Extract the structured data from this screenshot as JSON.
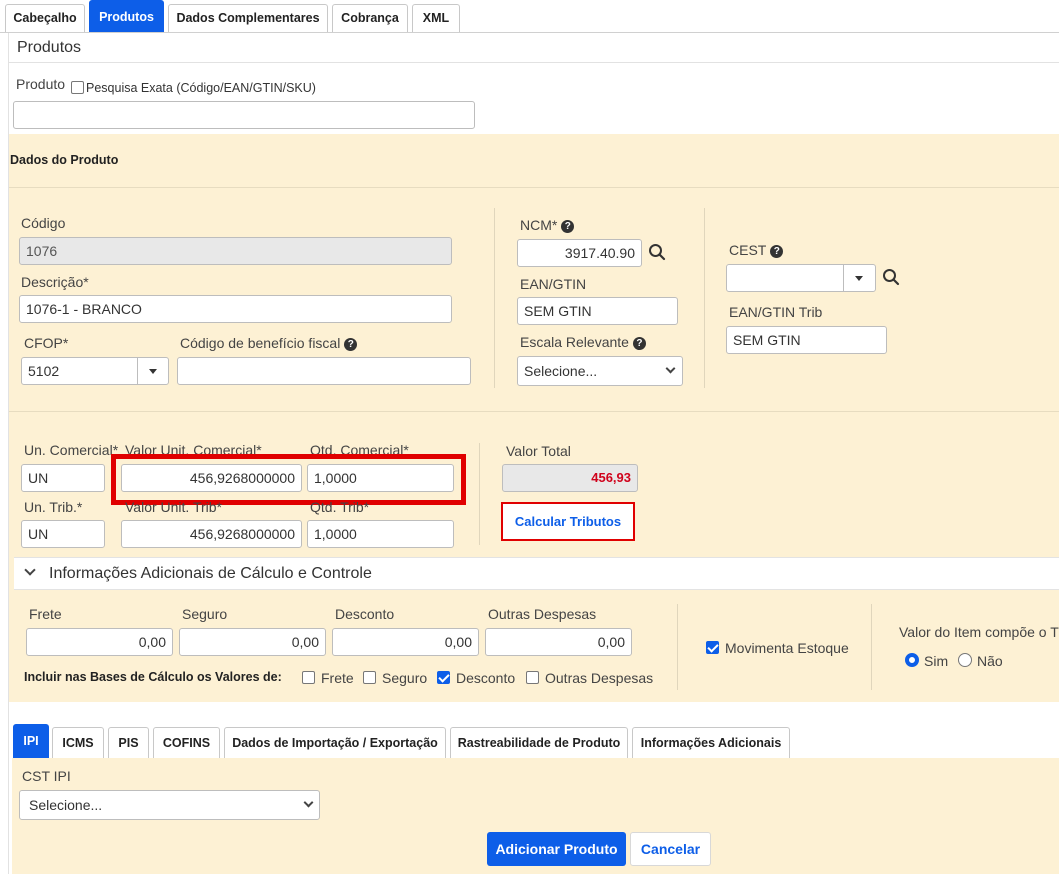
{
  "top_tabs": [
    "Cabeçalho",
    "Produtos",
    "Dados Complementares",
    "Cobrança",
    "XML"
  ],
  "section_title": "Produtos",
  "produto": {
    "label": "Produto",
    "exact_search_label": "Pesquisa Exata (Código/EAN/GTIN/SKU)",
    "value": ""
  },
  "dados_do_produto": {
    "title": "Dados do Produto",
    "codigo_label": "Código",
    "codigo_value": "1076",
    "descricao_label": "Descrição*",
    "descricao_value": "1076-1 - BRANCO",
    "cfop_label": "CFOP*",
    "cfop_value": "5102",
    "beneficio_label": "Código de benefício fiscal",
    "beneficio_value": "",
    "ncm_label": "NCM*",
    "ncm_value": "3917.40.90",
    "ean_label": "EAN/GTIN",
    "ean_value": "SEM GTIN",
    "escala_label": "Escala Relevante",
    "escala_value": "Selecione...",
    "cest_label": "CEST",
    "cest_value": "",
    "ean_trib_label": "EAN/GTIN Trib",
    "ean_trib_value": "SEM GTIN"
  },
  "valores": {
    "un_comercial_label": "Un. Comercial*",
    "un_comercial_value": "UN",
    "valor_unit_comercial_label": "Valor Unit. Comercial*",
    "valor_unit_comercial_value": "456,9268000000",
    "qtd_comercial_label": "Qtd. Comercial*",
    "qtd_comercial_value": "1,0000",
    "un_trib_label": "Un. Trib.*",
    "un_trib_value": "UN",
    "valor_unit_trib_label": "Valor Unit. Trib*",
    "valor_unit_trib_value": "456,9268000000",
    "qtd_trib_label": "Qtd. Trib*",
    "qtd_trib_value": "1,0000",
    "valor_total_label": "Valor Total",
    "valor_total_value": "456,93",
    "calcular_tributos_label": "Calcular Tributos"
  },
  "info_adicionais": {
    "title": "Informações Adicionais de Cálculo e Controle",
    "frete_label": "Frete",
    "frete_value": "0,00",
    "seguro_label": "Seguro",
    "seguro_value": "0,00",
    "desconto_label": "Desconto",
    "desconto_value": "0,00",
    "outras_label": "Outras Despesas",
    "outras_value": "0,00",
    "incluir_label": "Incluir nas Bases de Cálculo os Valores de:",
    "incluir_options": [
      {
        "label": "Frete",
        "checked": false
      },
      {
        "label": "Seguro",
        "checked": false
      },
      {
        "label": "Desconto",
        "checked": true
      },
      {
        "label": "Outras Despesas",
        "checked": false
      }
    ],
    "movimenta_estoque_label": "Movimenta Estoque",
    "movimenta_estoque_checked": true,
    "valor_item_label": "Valor do Item compõe o T",
    "sim_label": "Sim",
    "nao_label": "Não",
    "selected": "Sim"
  },
  "tax_tabs": [
    "IPI",
    "ICMS",
    "PIS",
    "COFINS",
    "Dados de Importação / Exportação",
    "Rastreabilidade de Produto",
    "Informações Adicionais"
  ],
  "ipi": {
    "cst_label": "CST IPI",
    "cst_value": "Selecione..."
  },
  "actions": {
    "add_label": "Adicionar Produto",
    "cancel_label": "Cancelar"
  },
  "colors": {
    "accent": "#0d5ee8",
    "panel": "#fdf1d4",
    "highlight_border": "#e00000",
    "total_text": "#d0021b"
  }
}
